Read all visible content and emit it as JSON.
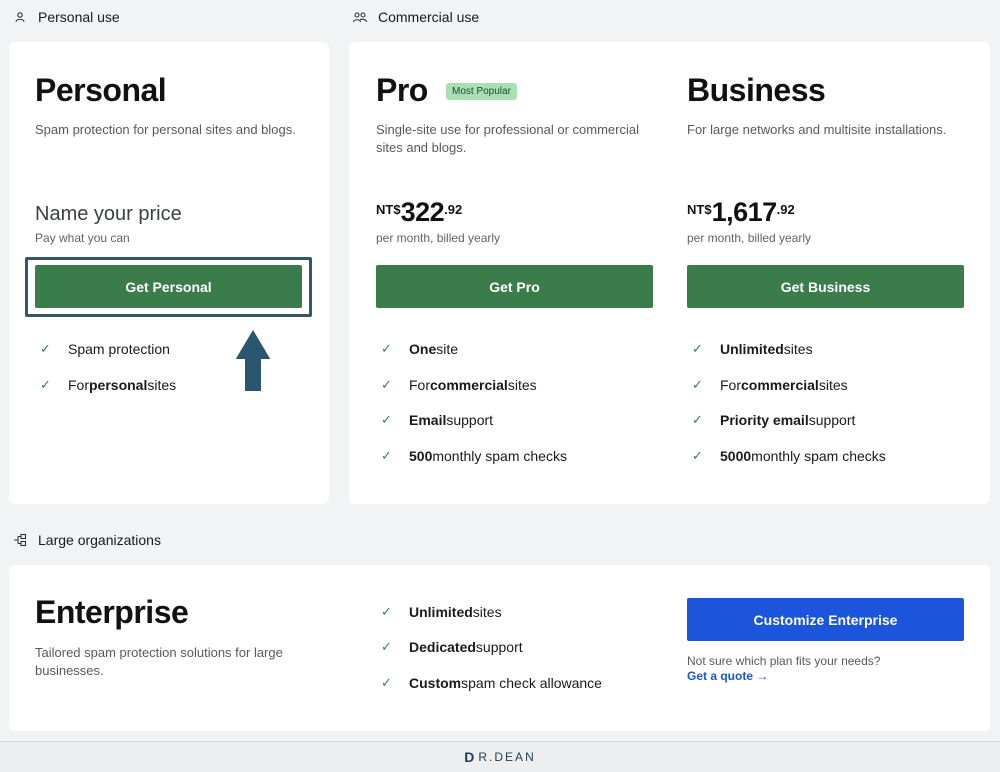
{
  "sections": {
    "personal_use": "Personal use",
    "commercial_use": "Commercial use",
    "large_orgs": "Large organizations"
  },
  "personal": {
    "title": "Personal",
    "desc": "Spam protection for personal sites and blogs.",
    "price_heading": "Name your price",
    "price_sub": "Pay what you can",
    "button": "Get Personal",
    "features": [
      {
        "pre": "",
        "bold": "",
        "post": "Spam protection"
      },
      {
        "pre": "For ",
        "bold": "personal",
        "post": " sites"
      }
    ]
  },
  "pro": {
    "title": "Pro",
    "badge": "Most Popular",
    "desc_line1": "Single-site use for professional or commercial",
    "desc_line2": "sites and blogs.",
    "currency": "NT$",
    "amount": "322",
    "cents": ".92",
    "billing": "per month, billed yearly",
    "button": "Get Pro",
    "features": [
      {
        "pre": "",
        "bold": "One",
        "post": " site"
      },
      {
        "pre": "For ",
        "bold": "commercial",
        "post": " sites"
      },
      {
        "pre": "",
        "bold": "Email",
        "post": " support"
      },
      {
        "pre": "",
        "bold": "500",
        "post": " monthly spam checks"
      }
    ]
  },
  "business": {
    "title": "Business",
    "desc": "For large networks and multisite installations.",
    "currency": "NT$",
    "amount": "1,617",
    "cents": ".92",
    "billing": "per month, billed yearly",
    "button": "Get Business",
    "features": [
      {
        "pre": "",
        "bold": "Unlimited",
        "post": " sites"
      },
      {
        "pre": "For ",
        "bold": "commercial",
        "post": " sites"
      },
      {
        "pre": "",
        "bold": "Priority email",
        "post": " support"
      },
      {
        "pre": "",
        "bold": "5000",
        "post": " monthly spam checks"
      }
    ]
  },
  "enterprise": {
    "title": "Enterprise",
    "desc_line1": "Tailored spam protection solutions for large",
    "desc_line2": "businesses.",
    "features": [
      {
        "pre": "",
        "bold": "Unlimited",
        "post": " sites"
      },
      {
        "pre": "",
        "bold": "Dedicated",
        "post": " support"
      },
      {
        "pre": "",
        "bold": "Custom",
        "post": " spam check allowance"
      }
    ],
    "button": "Customize Enterprise",
    "quote_text": "Not sure which plan fits your needs?",
    "quote_link": "Get a quote →"
  },
  "footer": {
    "logo_text": "R.DEAN",
    "logo_mark": "D"
  },
  "colors": {
    "green": "#3a7d4a",
    "blue": "#1a55dc",
    "highlight": "#35566b"
  }
}
